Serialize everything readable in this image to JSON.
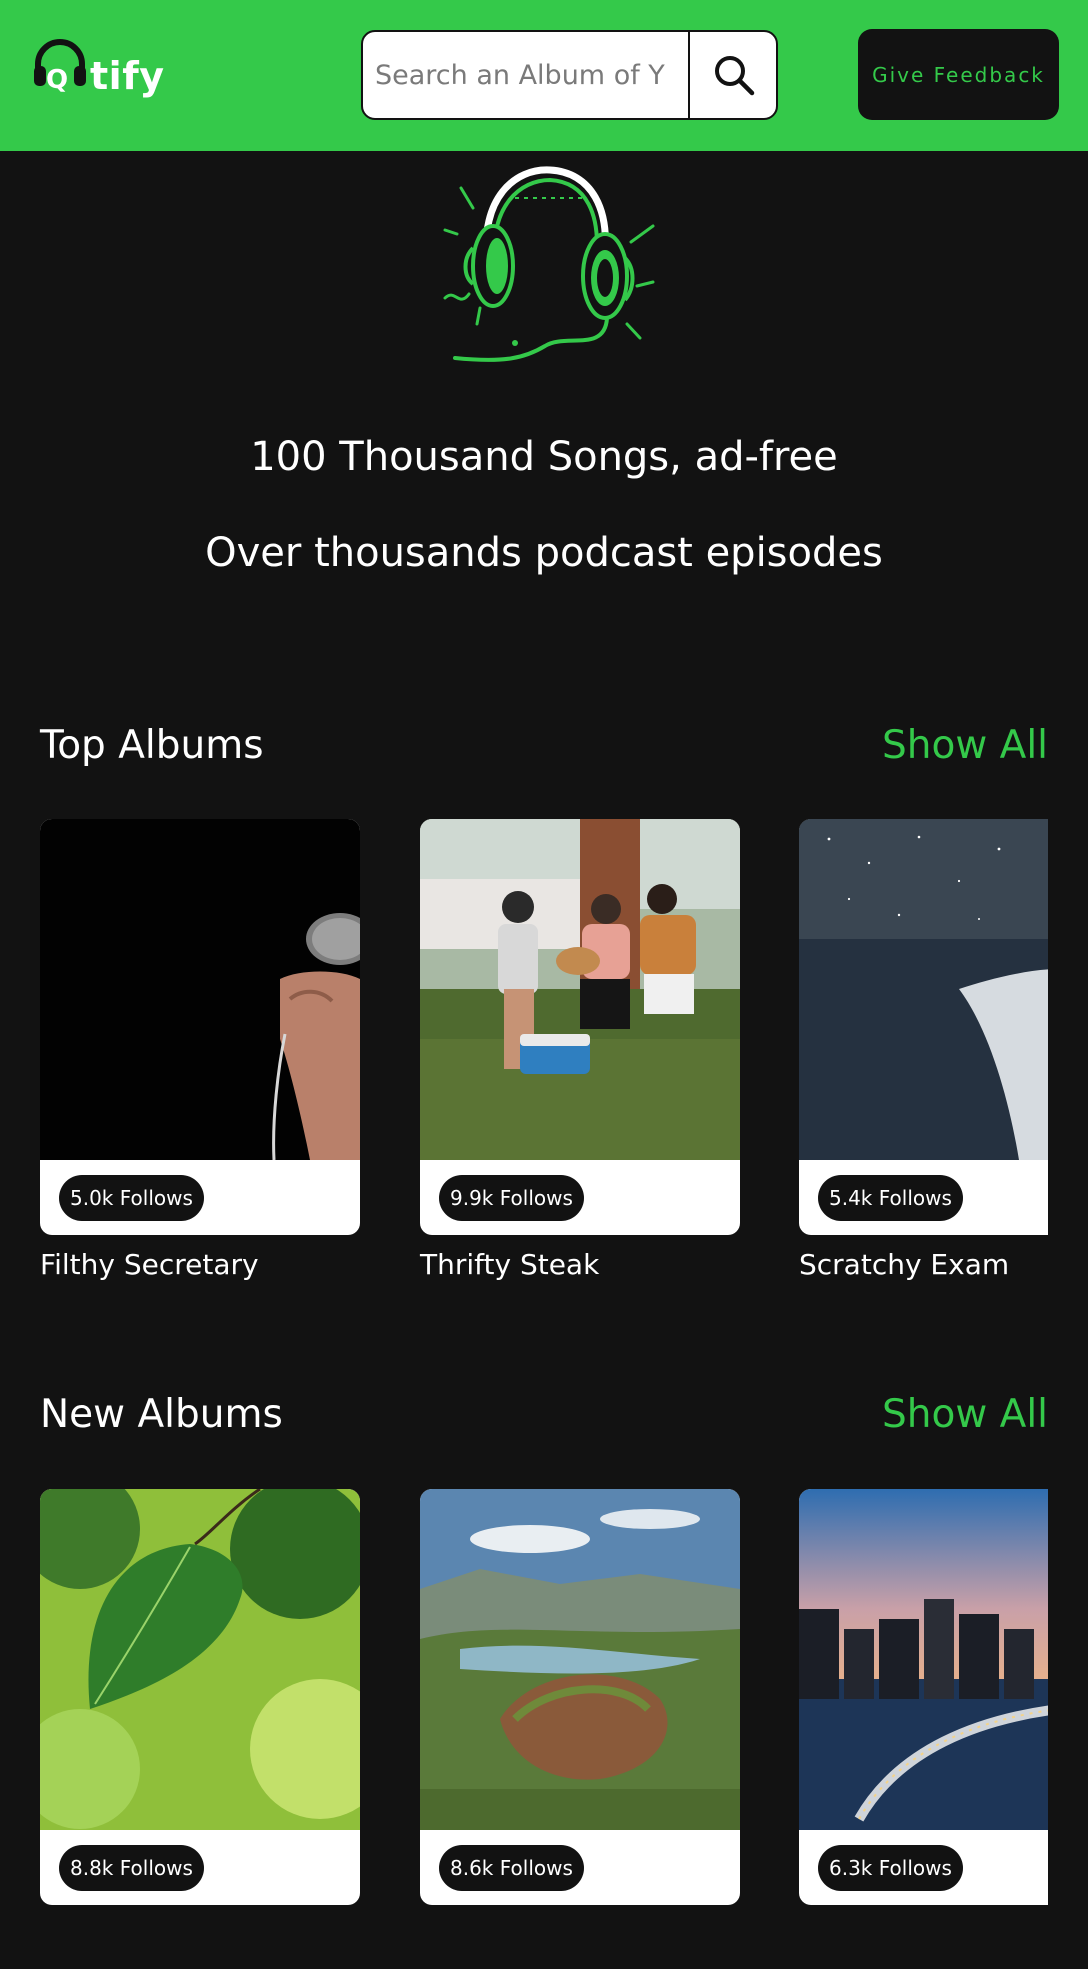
{
  "brand": {
    "logo_text": "tify",
    "accent_color": "#34c94a",
    "background_color": "#121212"
  },
  "search": {
    "placeholder": "Search an Album of Y",
    "value": "",
    "button_icon": "search-icon"
  },
  "feedback_button": {
    "label": "Give Feedback"
  },
  "hero": {
    "illustration": "headphones-illustration",
    "line1": "100 Thousand Songs, ad-free",
    "line2": "Over thousands podcast episodes"
  },
  "sections": [
    {
      "title": "Top Albums",
      "show_all": "Show All",
      "cards": [
        {
          "title": "Filthy Secretary",
          "follows": "5.0k Follows",
          "image": "microphone-photo"
        },
        {
          "title": "Thrifty Steak",
          "follows": "9.9k Follows",
          "image": "friends-guitar-photo"
        },
        {
          "title": "Scratchy Exam",
          "follows": "5.4k Follows",
          "image": "night-sky-photo"
        }
      ]
    },
    {
      "title": "New Albums",
      "show_all": "Show All",
      "cards": [
        {
          "title": "",
          "follows": "8.8k Follows",
          "image": "leaf-photo"
        },
        {
          "title": "",
          "follows": "8.6k Follows",
          "image": "canyon-photo"
        },
        {
          "title": "",
          "follows": "6.3k Follows",
          "image": "city-bridge-photo"
        }
      ]
    }
  ]
}
